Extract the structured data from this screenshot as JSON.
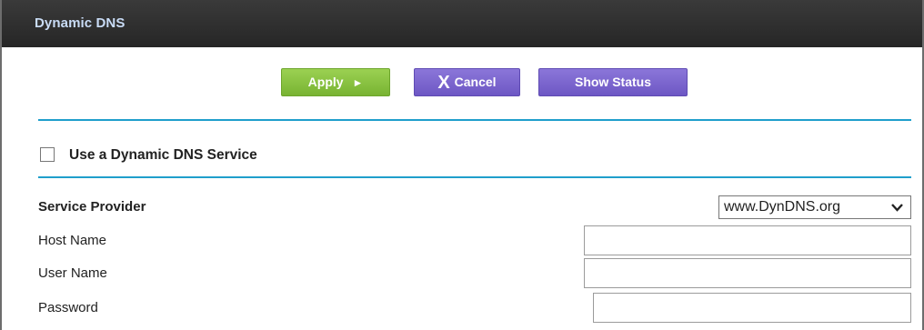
{
  "header": {
    "title": "Dynamic DNS"
  },
  "toolbar": {
    "apply_label": "Apply",
    "apply_icon": "►",
    "cancel_icon": "X",
    "cancel_label": "Cancel",
    "show_status_label": "Show Status"
  },
  "options": {
    "use_ddns_label": "Use a Dynamic DNS Service",
    "use_ddns_checked": false
  },
  "form": {
    "service_provider": {
      "label": "Service Provider",
      "selected": "www.DynDNS.org"
    },
    "host_name": {
      "label": "Host Name",
      "value": ""
    },
    "user_name": {
      "label": "User Name",
      "value": ""
    },
    "password": {
      "label": "Password",
      "value": ""
    }
  },
  "colors": {
    "title_bar": "#2f2f2f",
    "title_text": "#c9dcf6",
    "apply_button": "#8cc443",
    "purple_button": "#7b66d1",
    "divider": "#1f9fcc"
  },
  "icons": {
    "apply": "play-arrow-icon",
    "cancel": "close-icon",
    "select": "chevron-down-icon"
  }
}
